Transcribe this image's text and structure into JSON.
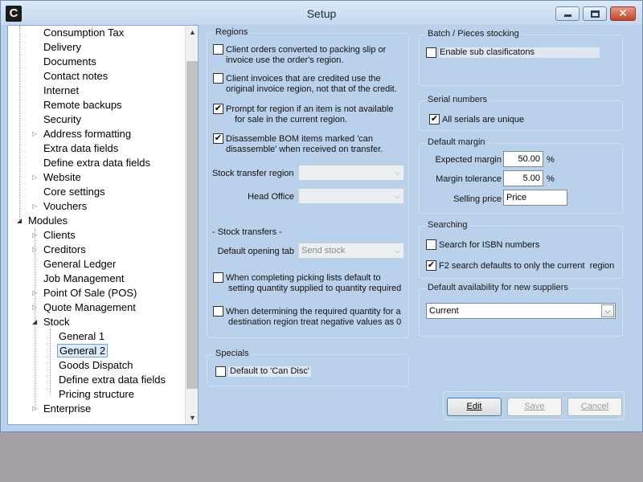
{
  "window": {
    "title": "Setup",
    "app_icon": "C"
  },
  "tree": [
    {
      "label": "Consumption Tax",
      "expander": ""
    },
    {
      "label": "Delivery",
      "expander": ""
    },
    {
      "label": "Documents",
      "expander": ""
    },
    {
      "label": "Contact notes",
      "expander": ""
    },
    {
      "label": "Internet",
      "expander": ""
    },
    {
      "label": "Remote backups",
      "expander": ""
    },
    {
      "label": "Security",
      "expander": ""
    },
    {
      "label": "Address formatting",
      "expander": "closed"
    },
    {
      "label": "Extra data fields",
      "expander": ""
    },
    {
      "label": "Define extra data fields",
      "expander": ""
    },
    {
      "label": "Website",
      "expander": "closed"
    },
    {
      "label": "Core settings",
      "expander": ""
    },
    {
      "label": "Vouchers",
      "expander": "closed"
    },
    {
      "label": "Modules",
      "expander": "open"
    },
    {
      "label": "Clients",
      "expander": "closed"
    },
    {
      "label": "Creditors",
      "expander": "closed"
    },
    {
      "label": "General Ledger",
      "expander": ""
    },
    {
      "label": "Job Management",
      "expander": ""
    },
    {
      "label": "Point Of Sale (POS)",
      "expander": "closed"
    },
    {
      "label": "Quote Management",
      "expander": "closed"
    },
    {
      "label": "Stock",
      "expander": "open"
    },
    {
      "label": "General 1",
      "expander": ""
    },
    {
      "label": "General 2",
      "expander": ""
    },
    {
      "label": "Goods Dispatch",
      "expander": ""
    },
    {
      "label": "Define extra data fields",
      "expander": ""
    },
    {
      "label": "Pricing structure",
      "expander": ""
    },
    {
      "label": "Enterprise",
      "expander": "closed"
    }
  ],
  "regions": {
    "title": "Regions",
    "cb1": {
      "line1": "Client orders converted to packing slip or",
      "line2": "invoice use the order's region.",
      "checked": false
    },
    "cb2": {
      "line1": "Client invoices that are credited use the",
      "line2": "original invoice region, not that of the credit.",
      "checked": false
    },
    "cb3": {
      "line1": "Prompt for region if an item is not available",
      "line2": "for sale in the current region.",
      "checked": true
    },
    "cb4": {
      "line1": "Disassemble BOM items marked 'can",
      "line2": "disassemble' when received on transfer.",
      "checked": true
    },
    "stock_transfer_region_label": "Stock transfer region",
    "head_office_label": "Head Office",
    "stock_transfers_heading": "- Stock transfers -",
    "default_opening_tab_label": "Default opening tab",
    "default_opening_tab_value": "Send stock",
    "cb5": {
      "line1": "When completing picking lists default to",
      "line2": "setting quantity supplied to quantity required",
      "checked": false
    },
    "cb6": {
      "line1": "When determining the required quantity for a",
      "line2": "destination region treat negative values as 0",
      "checked": false
    }
  },
  "specials": {
    "title": "Specials",
    "cb_label": "Default to 'Can Disc'",
    "checked": false
  },
  "batch": {
    "title": "Batch / Pieces stocking",
    "cb_label": "Enable sub clasificatons",
    "checked": false
  },
  "serials": {
    "title": "Serial numbers",
    "cb_label": "All serials are unique",
    "checked": true
  },
  "margin": {
    "title": "Default margin",
    "expected_label": "Expected margin",
    "expected_value": "50.00",
    "expected_unit": "%",
    "tolerance_label": "Margin tolerance",
    "tolerance_value": "5.00",
    "tolerance_unit": "%",
    "selling_label": "Selling price",
    "selling_value": "Price"
  },
  "searching": {
    "title": "Searching",
    "cb1_label": "Search for ISBN numbers",
    "cb1_checked": false,
    "cb2_label": "F2 search defaults to only the current  region",
    "cb2_checked": true
  },
  "availability": {
    "title": "Default availability for new suppliers",
    "value": "Current"
  },
  "buttons": {
    "edit": "Edit",
    "save": "Save",
    "cancel": "Cancel"
  },
  "icons": {
    "check": "✔",
    "combo_arrow": "⌵"
  }
}
